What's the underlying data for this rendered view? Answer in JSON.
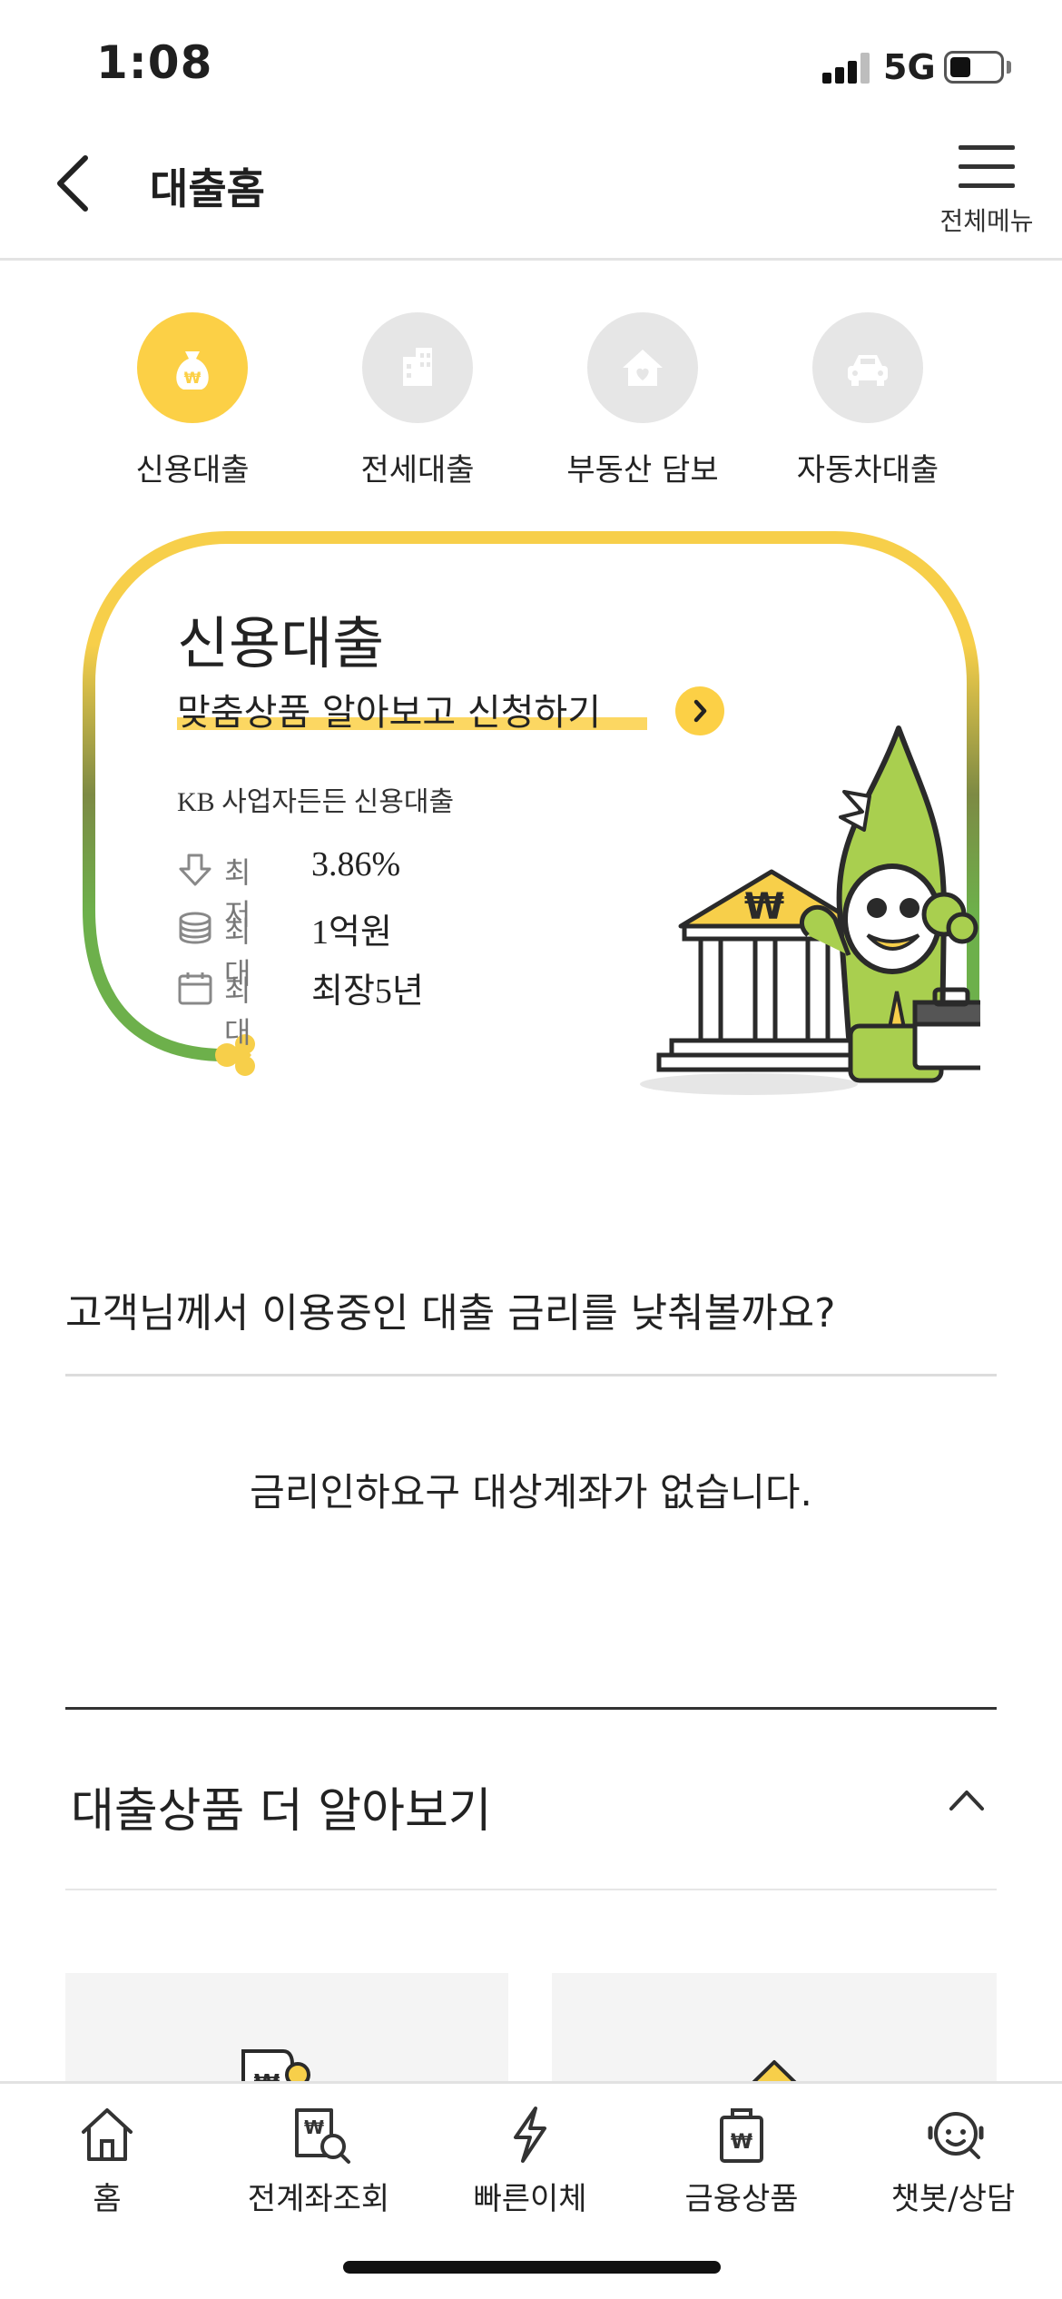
{
  "status_bar": {
    "time": "1:08",
    "network": "5G",
    "battery_level": 0.35
  },
  "header": {
    "title": "대출홈",
    "menu_label": "전체메뉴",
    "back_icon": "chevron-left-icon",
    "menu_icon": "hamburger-icon"
  },
  "categories": [
    {
      "label": "신용대출",
      "icon": "money-bag-icon",
      "active": true
    },
    {
      "label": "전세대출",
      "icon": "building-icon",
      "active": false
    },
    {
      "label": "부동산 담보",
      "icon": "house-icon",
      "active": false
    },
    {
      "label": "자동차대출",
      "icon": "car-icon",
      "active": false
    }
  ],
  "promo": {
    "title": "신용대출",
    "subtitle": "맞춤상품 알아보고 신청하기",
    "product_name": "KB 사업자든든 신용대출",
    "specs": [
      {
        "label": "최저",
        "value": "3.86%",
        "icon": "down-arrow-icon"
      },
      {
        "label": "최대",
        "value": "1억원",
        "icon": "coins-icon"
      },
      {
        "label": "최대",
        "value": "최장5년",
        "icon": "calendar-icon"
      }
    ]
  },
  "rate_section": {
    "question": "고객님께서 이용중인 대출 금리를 낮춰볼까요?",
    "empty_message": "금리인하요구 대상계좌가 없습니다."
  },
  "more_section": {
    "title": "대출상품 더 알아보기"
  },
  "tabs": [
    {
      "label": "홈",
      "icon": "home-icon"
    },
    {
      "label": "전계좌조회",
      "icon": "account-search-icon"
    },
    {
      "label": "빠른이체",
      "icon": "lightning-icon"
    },
    {
      "label": "금융상품",
      "icon": "shopping-bag-icon"
    },
    {
      "label": "챗봇/상담",
      "icon": "chatbot-icon"
    }
  ],
  "colors": {
    "accent": "#fcd046",
    "green": "#6db04b",
    "inactive": "#e6e6e6"
  }
}
